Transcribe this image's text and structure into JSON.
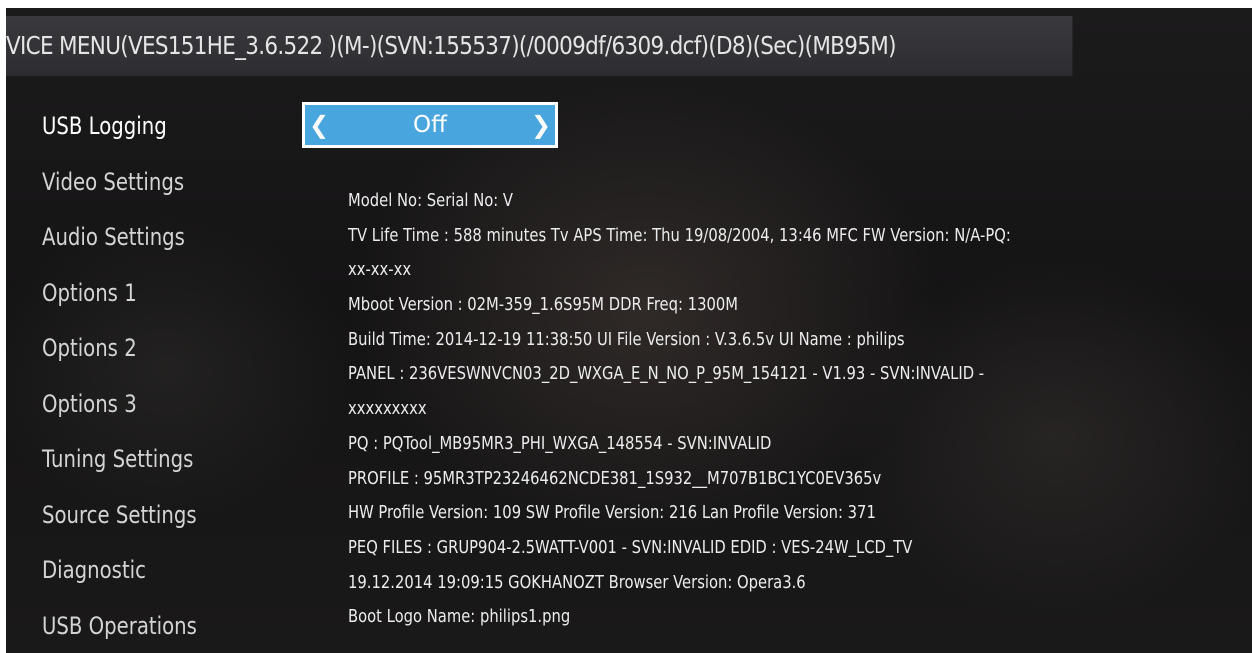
{
  "window": {
    "title": "VICE MENU(VES151HE_3.6.522 )(M-)(SVN:155537)(/0009df/6309.dcf)(D8)(Sec)(MB95M)"
  },
  "menu": {
    "items": [
      {
        "label": "USB Logging"
      },
      {
        "label": "Video Settings"
      },
      {
        "label": "Audio Settings"
      },
      {
        "label": "Options 1"
      },
      {
        "label": "Options 2"
      },
      {
        "label": "Options 3"
      },
      {
        "label": "Tuning Settings"
      },
      {
        "label": "Source Settings"
      },
      {
        "label": "Diagnostic"
      },
      {
        "label": "USB Operations"
      }
    ],
    "selected_index": 0
  },
  "selector": {
    "value": "Off",
    "left_icon": "chevron-left-icon",
    "right_icon": "chevron-right-icon"
  },
  "info": {
    "lines": [
      "Model No:   Serial No: V",
      "TV Life Time : 588 minutes  Tv APS Time: Thu 19/08/2004, 13:46 MFC FW Version: N/A-PQ:",
      "xx-xx-xx",
      "Mboot Version : 02M-359_1.6S95M  DDR Freq: 1300M",
      "Build Time: 2014-12-19 11:38:50  UI File Version : V.3.6.5v  UI Name : philips",
      "PANEL : 236VESWNVCN03_2D_WXGA_E_N_NO_P_95M_154121 - V1.93 - SVN:INVALID -",
      "xxxxxxxxx",
      "PQ : PQTool_MB95MR3_PHI_WXGA_148554 - SVN:INVALID",
      "PROFILE : 95MR3TP23246462NCDE381_1S932__M707B1BC1YC0EV365v",
      "HW Profile Version: 109  SW Profile Version: 216  Lan Profile Version: 371",
      "PEQ FILES : GRUP904-2.5WATT-V001 - SVN:INVALID    EDID : VES-24W_LCD_TV",
      "19.12.2014 19:09:15 GOKHANOZT  Browser Version: Opera3.6",
      "Boot Logo Name: philips1.png"
    ]
  },
  "colors": {
    "selector_fill": "#49a5dd",
    "title_bar": "#323236",
    "background": "#181718"
  }
}
